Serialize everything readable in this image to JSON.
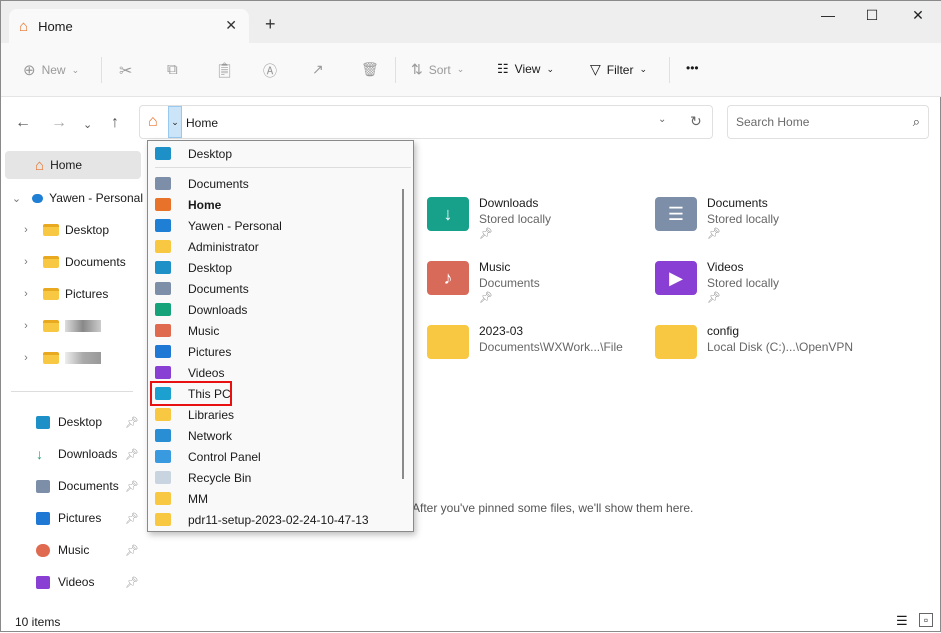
{
  "window": {
    "tab_title": "Home",
    "close": "✕",
    "new_tab": "+",
    "minimize": "—",
    "maximize": "☐",
    "close_window": "✕"
  },
  "toolbar": {
    "new": "New",
    "sort": "Sort",
    "view": "View",
    "filter": "Filter",
    "more": "•••"
  },
  "address": {
    "current": "Home",
    "search_placeholder": "Search Home"
  },
  "sidebar": {
    "home": "Home",
    "onedrive": "Yawen - Personal",
    "onedrive_children": [
      "Desktop",
      "Documents",
      "Pictures"
    ],
    "quick": [
      "Desktop",
      "Downloads",
      "Documents",
      "Pictures",
      "Music",
      "Videos"
    ]
  },
  "dropdown": {
    "top": "Desktop",
    "items": [
      {
        "label": "Documents",
        "icon": "documents-icon",
        "color": "#7d8fa8"
      },
      {
        "label": "Home",
        "icon": "home-icon",
        "color": "#e8722a",
        "bold": true
      },
      {
        "label": "Yawen - Personal",
        "icon": "onedrive-icon",
        "color": "#1f7fd4"
      },
      {
        "label": "Administrator",
        "icon": "folder-icon",
        "color": "#f8c843"
      },
      {
        "label": "Desktop",
        "icon": "desktop-icon",
        "color": "#1e90c8"
      },
      {
        "label": "Documents",
        "icon": "documents-icon",
        "color": "#7d8fa8"
      },
      {
        "label": "Downloads",
        "icon": "downloads-icon",
        "color": "#17a37a"
      },
      {
        "label": "Music",
        "icon": "music-icon",
        "color": "#e06a50"
      },
      {
        "label": "Pictures",
        "icon": "pictures-icon",
        "color": "#1e78d4"
      },
      {
        "label": "Videos",
        "icon": "videos-icon",
        "color": "#8a3fd4"
      },
      {
        "label": "This PC",
        "icon": "this-pc-icon",
        "color": "#1ba0d0"
      },
      {
        "label": "Libraries",
        "icon": "libraries-icon",
        "color": "#f8c843"
      },
      {
        "label": "Network",
        "icon": "network-icon",
        "color": "#2a8ed4"
      },
      {
        "label": "Control Panel",
        "icon": "control-panel-icon",
        "color": "#3a9ae0"
      },
      {
        "label": "Recycle Bin",
        "icon": "recycle-bin-icon",
        "color": "#c8d4e0"
      },
      {
        "label": "MM",
        "icon": "folder-icon",
        "color": "#f8c843"
      },
      {
        "label": "pdr11-setup-2023-02-24-10-47-13",
        "icon": "folder-icon",
        "color": "#f8c843"
      }
    ]
  },
  "content": {
    "tiles": [
      {
        "name": "Downloads",
        "sub": "Stored locally",
        "pinned": true,
        "color": "#17a08a",
        "glyph": "↓"
      },
      {
        "name": "Documents",
        "sub": "Stored locally",
        "pinned": true,
        "color": "#7d8fa8",
        "glyph": "☰"
      },
      {
        "name": "Music",
        "sub": "Documents",
        "pinned": true,
        "color": "#d86a5a",
        "glyph": "♪"
      },
      {
        "name": "Videos",
        "sub": "Stored locally",
        "pinned": true,
        "color": "#8a3fd4",
        "glyph": "▶"
      },
      {
        "name": "2023-03",
        "sub": "Documents\\WXWork...\\File",
        "pinned": false,
        "color": "#f8c843",
        "glyph": ""
      },
      {
        "name": "config",
        "sub": "Local Disk (C:)...\\OpenVPN",
        "pinned": false,
        "color": "#f8c843",
        "glyph": ""
      }
    ],
    "empty_message": "After you've pinned some files, we'll show them here."
  },
  "status": {
    "count": "10 items"
  }
}
